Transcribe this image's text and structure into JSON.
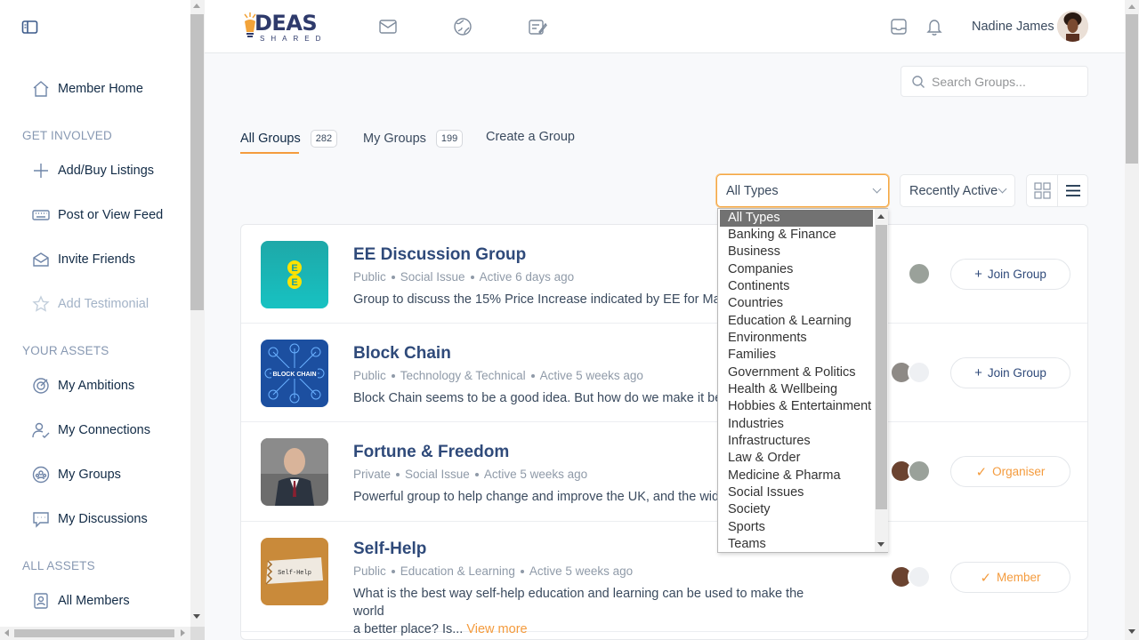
{
  "sidebar": {
    "items": [
      {
        "label": "Member Home",
        "icon": "home-icon"
      },
      {
        "label": "Add/Buy Listings",
        "icon": "plus-icon"
      },
      {
        "label": "Post or View Feed",
        "icon": "keyboard-icon"
      },
      {
        "label": "Invite Friends",
        "icon": "envelope-open-icon"
      },
      {
        "label": "Add Testimonial",
        "icon": "star-icon"
      },
      {
        "label": "My Ambitions",
        "icon": "target-icon"
      },
      {
        "label": "My Connections",
        "icon": "user-check-icon"
      },
      {
        "label": "My Groups",
        "icon": "groups-icon"
      },
      {
        "label": "My Discussions",
        "icon": "chat-icon"
      },
      {
        "label": "All Members",
        "icon": "member-card-icon"
      }
    ],
    "headings": [
      "GET INVOLVED",
      "YOUR ASSETS",
      "ALL ASSETS"
    ]
  },
  "header": {
    "logo_text": "DEAS",
    "logo_sub": "SHARED",
    "user_name": "Nadine James"
  },
  "search": {
    "placeholder": "Search Groups..."
  },
  "tabs": [
    {
      "label": "All Groups",
      "count": "282"
    },
    {
      "label": "My Groups",
      "count": "199"
    },
    {
      "label": "Create a Group"
    }
  ],
  "filters": {
    "type_selected": "All Types",
    "order_selected": "Recently Active"
  },
  "type_options": [
    "All Types",
    "Banking & Finance",
    "Business",
    "Companies",
    "Continents",
    "Countries",
    "Education & Learning",
    "Environments",
    "Families",
    "Government & Politics",
    "Health & Wellbeing",
    "Hobbies & Entertainment",
    "Industries",
    "Infrastructures",
    "Law & Order",
    "Medicine & Pharma",
    "Social Issues",
    "Society",
    "Sports",
    "Teams"
  ],
  "groups": [
    {
      "title": "EE Discussion Group",
      "privacy": "Public",
      "type": "Social Issue",
      "activity": "Active 6 days ago",
      "desc": "Group to discuss the 15% Price Increase indicated by EE for March",
      "button": "Join Group",
      "button_icon": "+"
    },
    {
      "title": "Block Chain",
      "privacy": "Public",
      "type": "Technology & Technical",
      "activity": "Active 5 weeks ago",
      "desc": "Block Chain seems to be a good idea. But how do we make it bette",
      "button": "Join Group",
      "button_icon": "+",
      "img_text": "BLOCK CHAIN"
    },
    {
      "title": "Fortune & Freedom",
      "privacy": "Private",
      "type": "Social Issue",
      "activity": "Active 5 weeks ago",
      "desc": "Powerful group to help change and improve the UK, and the wider",
      "button": "Organiser",
      "button_icon": "✓"
    },
    {
      "title": "Self-Help",
      "privacy": "Public",
      "type": "Education & Learning",
      "activity": "Active 5 weeks ago",
      "desc": "What is the best way self-help education and learning can be used to make the world",
      "desc2": "a better place? Is...",
      "more": "View more",
      "button": "Member",
      "button_icon": "✓",
      "img_text": "Self-Help"
    }
  ]
}
